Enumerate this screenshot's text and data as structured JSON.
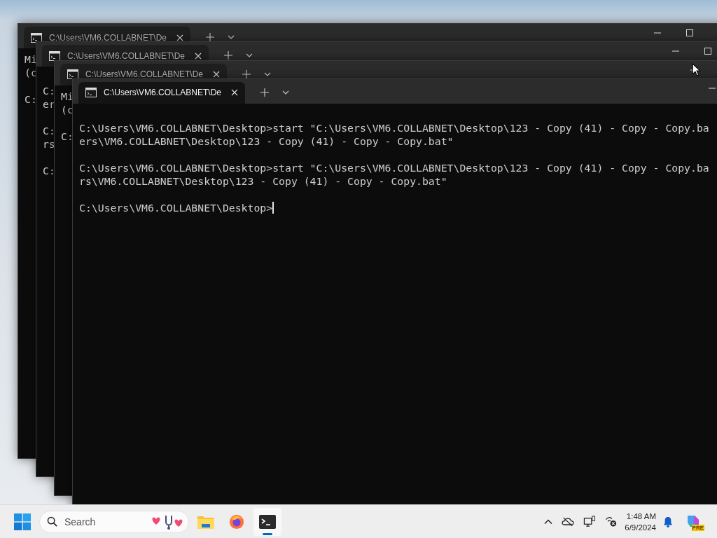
{
  "windows": [
    {
      "tab": {
        "title": "C:\\Users\\VM6.COLLABNET\\De"
      },
      "focused": false,
      "leading_blank_line": false,
      "controls": [
        {
          "kind": "minimize"
        },
        {
          "kind": "maximize"
        }
      ],
      "blocks": [
        [
          "Mi",
          "(c"
        ],
        [
          "C:"
        ]
      ]
    },
    {
      "tab": {
        "title": "C:\\Users\\VM6.COLLABNET\\De"
      },
      "focused": false,
      "leading_blank_line": true,
      "controls": [
        {
          "kind": "minimize"
        },
        {
          "kind": "maximize"
        }
      ],
      "blocks": [
        [
          "C:",
          "er"
        ],
        [
          "C:",
          "rs"
        ],
        [
          "C:"
        ]
      ]
    },
    {
      "tab": {
        "title": "C:\\Users\\VM6.COLLABNET\\De"
      },
      "focused": false,
      "leading_blank_line": false,
      "controls": [
        {
          "kind": "minimize"
        }
      ],
      "blocks": [
        [
          "Mi",
          "(c"
        ],
        [
          "C:"
        ]
      ]
    },
    {
      "tab": {
        "title": "C:\\Users\\VM6.COLLABNET\\De"
      },
      "focused": true,
      "leading_blank_line": true,
      "cursor": true,
      "controls": [
        {
          "kind": "minimize"
        }
      ],
      "blocks": [
        [
          "C:\\Users\\VM6.COLLABNET\\Desktop>start \"C:\\Users\\VM6.COLLABNET\\Desktop\\123 - Copy (41) - Copy - Copy.ba",
          "ers\\VM6.COLLABNET\\Desktop\\123 - Copy (41) - Copy - Copy.bat\""
        ],
        [
          "C:\\Users\\VM6.COLLABNET\\Desktop>start \"C:\\Users\\VM6.COLLABNET\\Desktop\\123 - Copy (41) - Copy - Copy.ba",
          "rs\\VM6.COLLABNET\\Desktop\\123 - Copy (41) - Copy - Copy.bat\""
        ],
        [
          "C:\\Users\\VM6.COLLABNET\\Desktop>"
        ]
      ]
    }
  ],
  "taskbar": {
    "search": {
      "placeholder": "Search"
    },
    "apps": [
      {
        "kind": "explorer",
        "active": false
      },
      {
        "kind": "firefox",
        "active": false
      },
      {
        "kind": "terminal",
        "active": true
      }
    ],
    "tray": {
      "icons": [
        {
          "kind": "chevron"
        },
        {
          "kind": "onedrive"
        },
        {
          "kind": "display"
        },
        {
          "kind": "network"
        }
      ],
      "time": "1:48 AM",
      "date": "6/9/2024",
      "badge": "PRE"
    }
  }
}
